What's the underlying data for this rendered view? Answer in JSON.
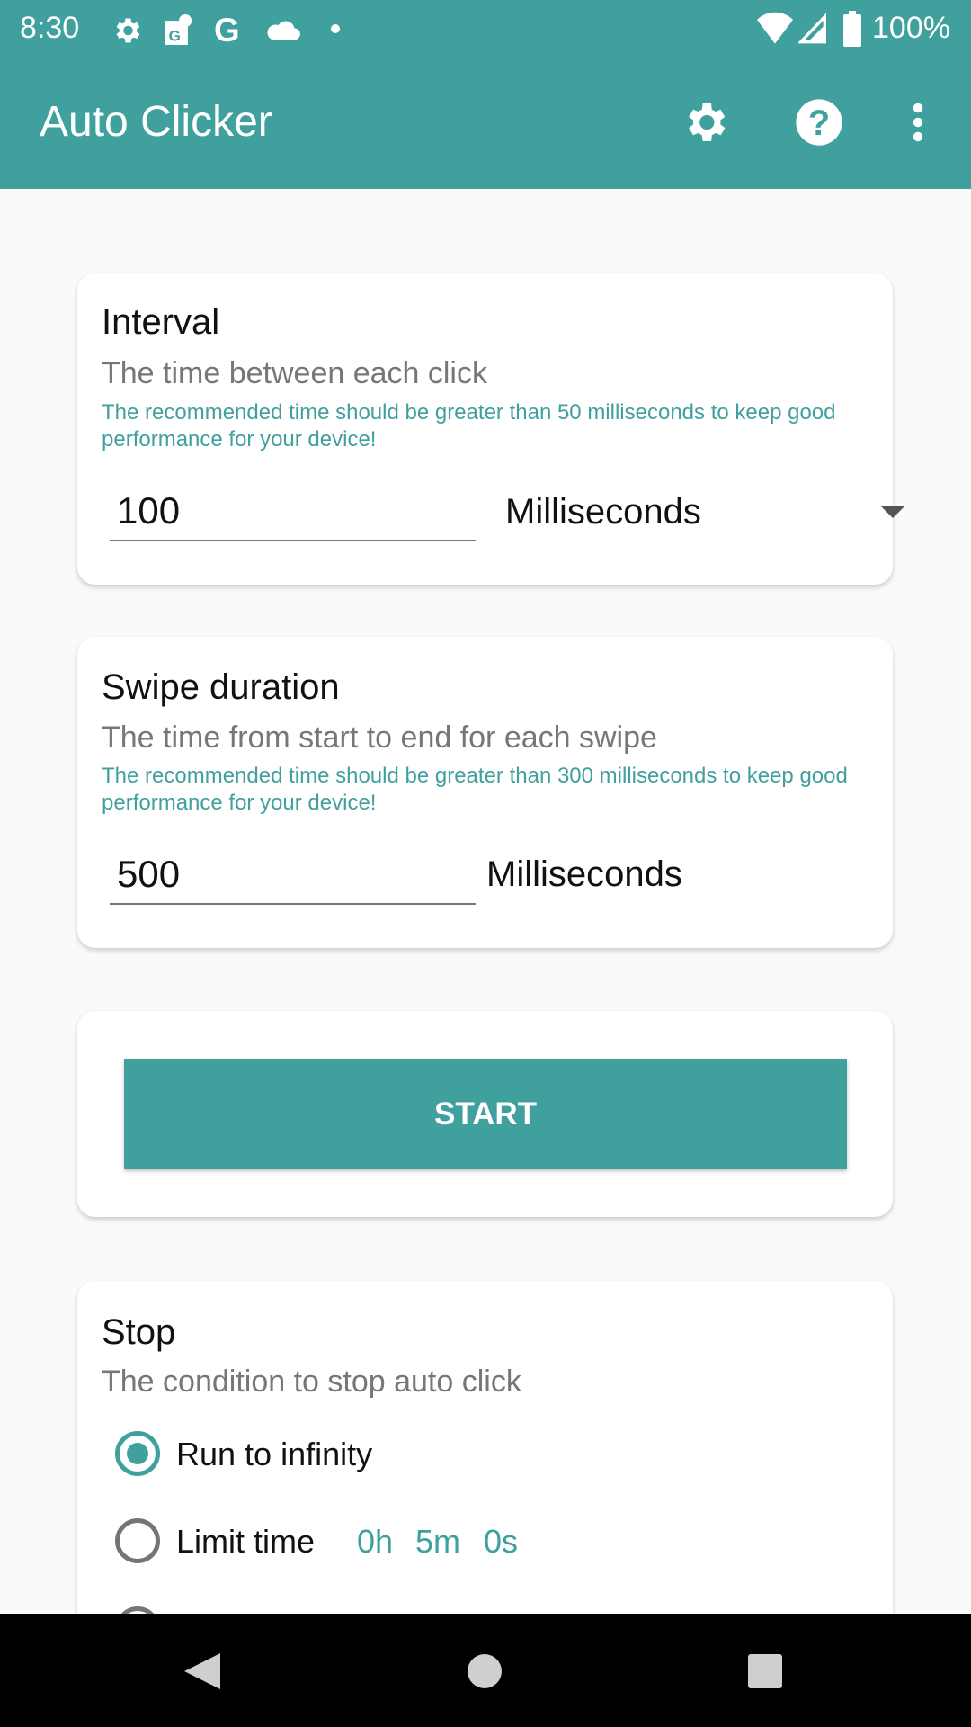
{
  "status_bar": {
    "time": "8:30",
    "battery": "100%",
    "icons": [
      "gear-icon",
      "maps-icon",
      "google-icon",
      "cloud-icon",
      "dot-icon",
      "wifi-icon",
      "signal-icon",
      "battery-icon"
    ]
  },
  "app_bar": {
    "title": "Auto Clicker",
    "actions": [
      "settings-icon",
      "help-icon",
      "more-vert-icon"
    ]
  },
  "interval": {
    "title": "Interval",
    "subtitle": "The time between each click",
    "hint": "The recommended time should be greater than 50 milliseconds to keep good performance for your device!",
    "value": "100",
    "unit": "Milliseconds"
  },
  "swipe": {
    "title": "Swipe duration",
    "subtitle": "The time from start to end for each swipe",
    "hint": "The recommended time should be greater than 300 milliseconds to keep good performance for your device!",
    "value": "500",
    "unit": "Milliseconds"
  },
  "start": {
    "label": "START"
  },
  "stop": {
    "title": "Stop",
    "subtitle": "The condition to stop auto click",
    "options": [
      {
        "label": "Run to infinity",
        "selected": true
      },
      {
        "label": "Limit time",
        "selected": false,
        "hours": "0h",
        "minutes": "5m",
        "seconds": "0s"
      }
    ]
  },
  "colors": {
    "accent": "#40a09e",
    "background": "#fafafa"
  }
}
